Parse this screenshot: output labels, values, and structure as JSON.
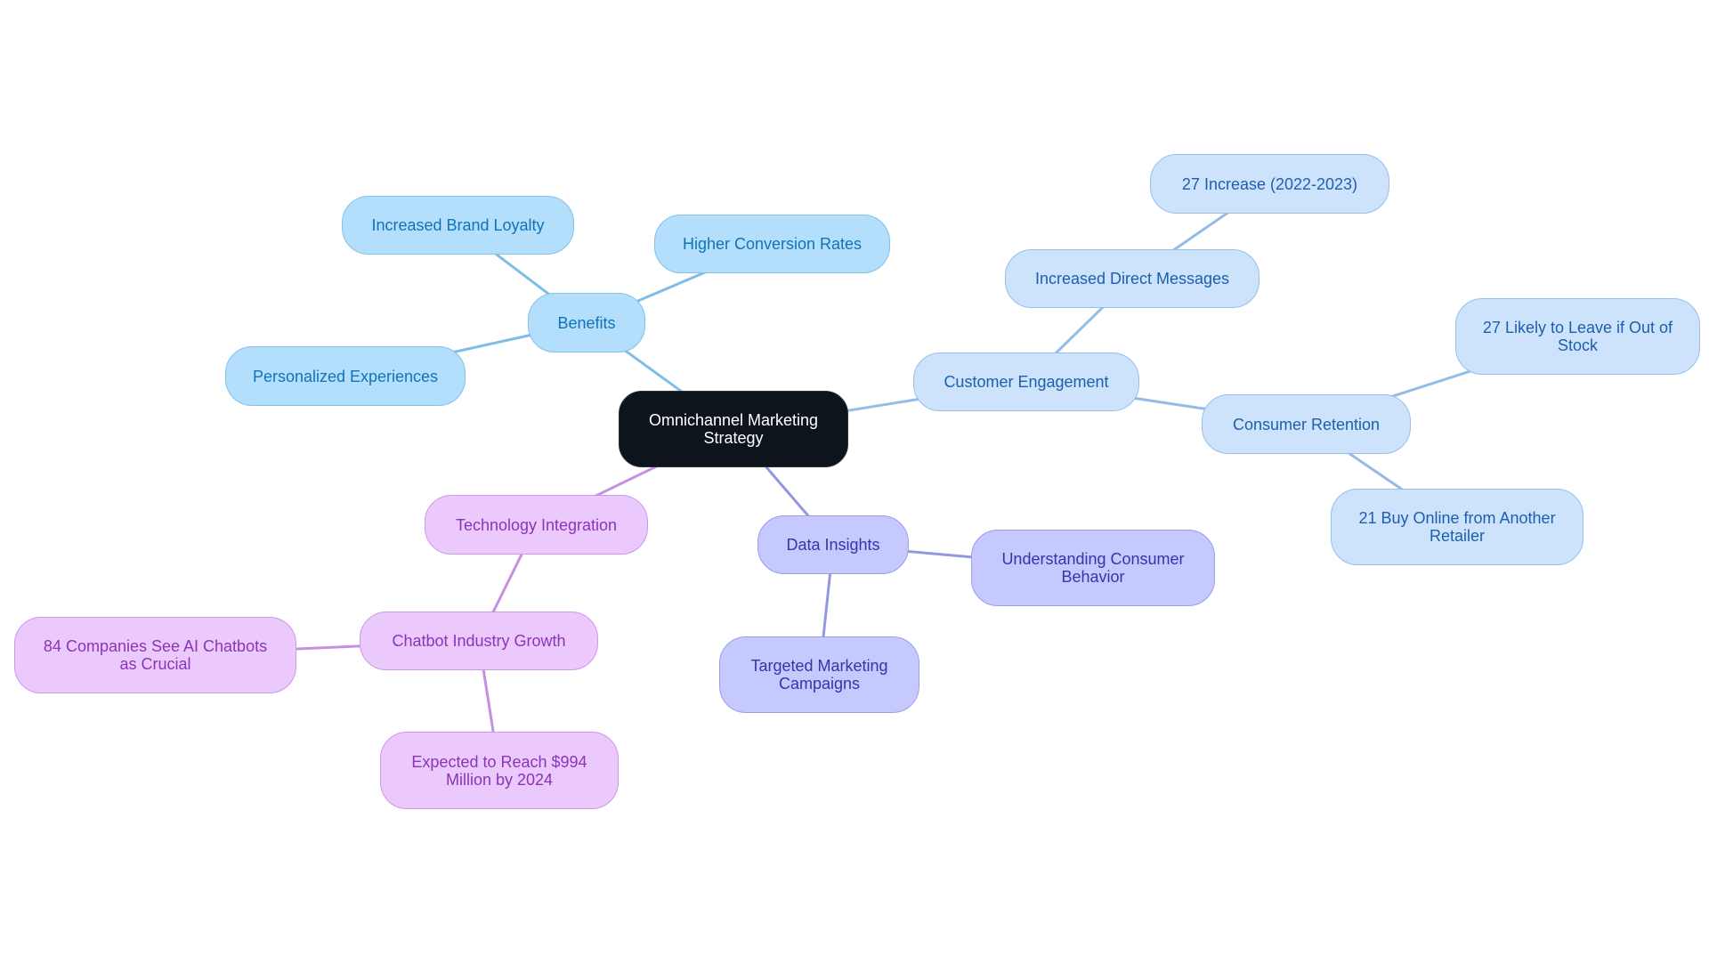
{
  "diagram": {
    "type": "mindmap",
    "colors": {
      "root_fill": "#0d141b",
      "benefits_branch": "#b3defc",
      "engagement_branch": "#cde3fb",
      "data_branch": "#c6c9fd",
      "technology_branch": "#ebc9fd",
      "benefits_edge": "#7dbde6",
      "engagement_edge": "#93bde6",
      "data_edge": "#9397e0",
      "technology_edge": "#c690e0"
    },
    "root": {
      "id": "root",
      "label": "Omnichannel Marketing Strategy"
    },
    "nodes": [
      {
        "id": "benefits",
        "label": "Benefits",
        "parent": "root",
        "branch": "blue"
      },
      {
        "id": "brand-loyalty",
        "label": "Increased Brand Loyalty",
        "parent": "benefits",
        "branch": "blue"
      },
      {
        "id": "conversion-rates",
        "label": "Higher Conversion Rates",
        "parent": "benefits",
        "branch": "blue"
      },
      {
        "id": "personalized",
        "label": "Personalized Experiences",
        "parent": "benefits",
        "branch": "blue"
      },
      {
        "id": "engagement",
        "label": "Customer Engagement",
        "parent": "root",
        "branch": "lblue"
      },
      {
        "id": "direct-messages",
        "label": "Increased Direct Messages",
        "parent": "engagement",
        "branch": "lblue"
      },
      {
        "id": "increase-27",
        "label": "27 Increase (2022-2023)",
        "parent": "direct-messages",
        "branch": "lblue"
      },
      {
        "id": "retention",
        "label": "Consumer Retention",
        "parent": "engagement",
        "branch": "lblue"
      },
      {
        "id": "likely-leave",
        "label": "27 Likely to Leave if Out of Stock",
        "parent": "retention",
        "branch": "lblue"
      },
      {
        "id": "buy-online",
        "label": "21 Buy Online from Another Retailer",
        "parent": "retention",
        "branch": "lblue"
      },
      {
        "id": "data-insights",
        "label": "Data Insights",
        "parent": "root",
        "branch": "indigo"
      },
      {
        "id": "consumer-behavior",
        "label": "Understanding Consumer Behavior",
        "parent": "data-insights",
        "branch": "indigo"
      },
      {
        "id": "targeted-campaigns",
        "label": "Targeted Marketing Campaigns",
        "parent": "data-insights",
        "branch": "indigo"
      },
      {
        "id": "tech-integration",
        "label": "Technology Integration",
        "parent": "root",
        "branch": "purple"
      },
      {
        "id": "chatbot-growth",
        "label": "Chatbot Industry Growth",
        "parent": "tech-integration",
        "branch": "purple"
      },
      {
        "id": "companies-84",
        "label": "84 Companies See AI Chatbots as Crucial",
        "parent": "chatbot-growth",
        "branch": "purple"
      },
      {
        "id": "reach-994",
        "label": "Expected to Reach $994 Million by 2024",
        "parent": "chatbot-growth",
        "branch": "purple"
      }
    ]
  }
}
